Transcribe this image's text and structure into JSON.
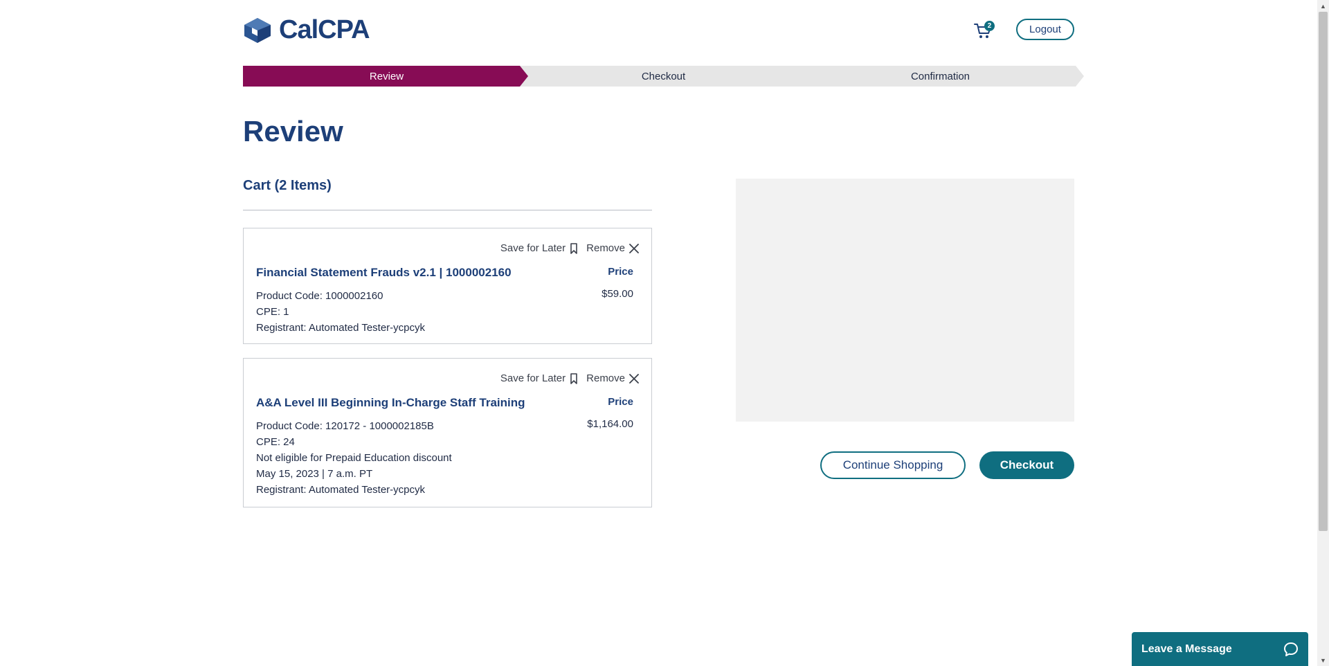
{
  "header": {
    "logo_text": "CalCPA",
    "cart_count": "2",
    "logout_label": "Logout"
  },
  "steps": [
    {
      "label": "Review",
      "active": true
    },
    {
      "label": "Checkout",
      "active": false
    },
    {
      "label": "Confirmation",
      "active": false
    }
  ],
  "page_title": "Review",
  "cart": {
    "heading": "Cart (2 Items)",
    "save_label": "Save for Later",
    "remove_label": "Remove",
    "price_label": "Price",
    "items": [
      {
        "title": "Financial Statement Frauds v2.1 | 1000002160",
        "price": "$59.00",
        "details": [
          "Product Code: 1000002160",
          "CPE: 1",
          "Registrant: Automated Tester-ycpcyk"
        ]
      },
      {
        "title": "A&A Level III Beginning In-Charge Staff Training",
        "price": "$1,164.00",
        "details": [
          "Product Code: 120172 - 1000002185B",
          "CPE: 24",
          "Not eligible for Prepaid Education discount",
          "May 15, 2023 | 7 a.m. PT",
          "Registrant: Automated Tester-ycpcyk"
        ]
      }
    ]
  },
  "actions": {
    "continue_label": "Continue Shopping",
    "checkout_label": "Checkout"
  },
  "chat": {
    "label": "Leave a Message"
  },
  "colors": {
    "active_step": "#870c55",
    "inactive_step": "#e6e6e6",
    "brand_blue": "#1d3f78",
    "teal": "#0f6e80"
  }
}
